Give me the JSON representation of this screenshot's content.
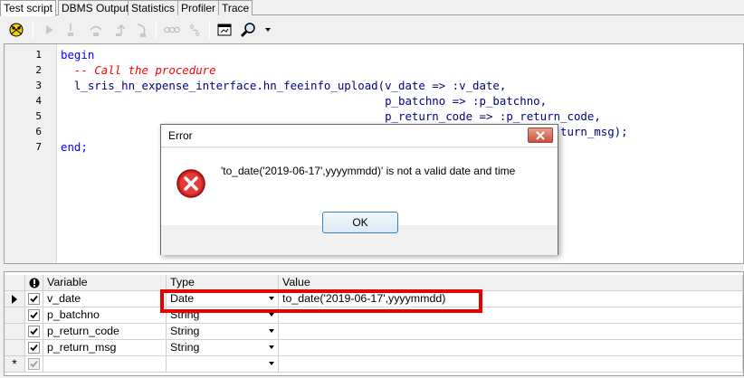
{
  "tabs": [
    {
      "label": "Test script",
      "active": true
    },
    {
      "label": "DBMS Output",
      "active": false
    },
    {
      "label": "Statistics",
      "active": false
    },
    {
      "label": "Profiler",
      "active": false
    },
    {
      "label": "Trace",
      "active": false
    }
  ],
  "toolbar": {
    "icons": [
      "debug-icon",
      "run-icon",
      "step-into-icon",
      "step-over-icon",
      "step-out-icon",
      "run-to-exception-icon",
      "toggle-breakpoint-icon",
      "break-icon",
      "output-window-icon",
      "find-icon",
      "dropdown-arrow-icon"
    ]
  },
  "editor": {
    "line_numbers": [
      "1",
      "2",
      "3",
      "4",
      "5",
      "6",
      "7"
    ],
    "lines": {
      "l1": "begin",
      "l2": "  -- Call the procedure",
      "l3": "  l_sris_hn_expense_interface.hn_feeinfo_upload(v_date => :v_date,",
      "l4": "                                                p_batchno => :p_batchno,",
      "l5": "                                                p_return_code => :p_return_code,",
      "l6_tail": "turn_msg);",
      "l7": "end;"
    }
  },
  "dialog": {
    "title": "Error",
    "message": "'to_date('2019-06-17',yyyymmdd)' is not a valid date and time",
    "ok_label": "OK"
  },
  "grid": {
    "headers": {
      "variable": "Variable",
      "type": "Type",
      "value": "Value"
    },
    "rows": [
      {
        "variable": "v_date",
        "type": "Date",
        "value": "to_date('2019-06-17',yyyymmdd)",
        "current": true
      },
      {
        "variable": "p_batchno",
        "type": "String",
        "value": ""
      },
      {
        "variable": "p_return_code",
        "type": "String",
        "value": ""
      },
      {
        "variable": "p_return_msg",
        "type": "String",
        "value": ""
      }
    ],
    "new_row_marker": "*"
  },
  "colors": {
    "highlight_border": "#e60000",
    "keyword": "#0000ff",
    "comment": "#ff0000",
    "identifier": "#000080"
  }
}
